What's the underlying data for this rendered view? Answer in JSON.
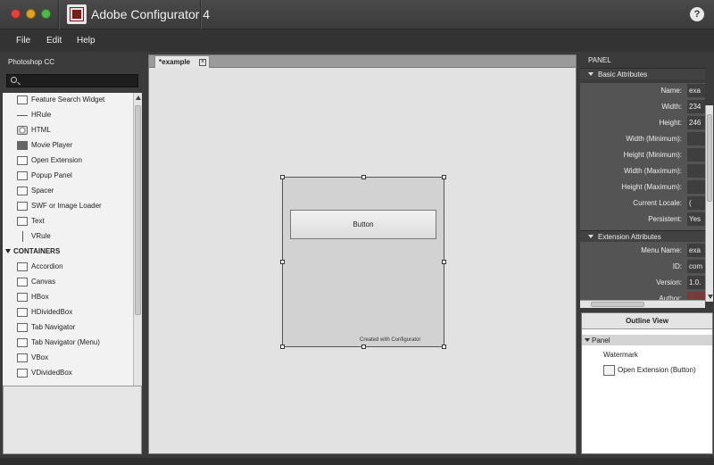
{
  "window": {
    "title": "Adobe Configurator 4",
    "help": "?"
  },
  "menu": [
    "File",
    "Edit",
    "Help"
  ],
  "left_panel": {
    "title": "Photoshop CC",
    "search_placeholder": "",
    "items": [
      {
        "label": "Feature Search Widget",
        "icon": "search-widget-icon"
      },
      {
        "label": "HRule",
        "icon": "hrule-icon"
      },
      {
        "label": "HTML",
        "icon": "html-icon"
      },
      {
        "label": "Movie Player",
        "icon": "film-icon"
      },
      {
        "label": "Open Extension",
        "icon": "window-icon"
      },
      {
        "label": "Popup Panel",
        "icon": "popup-icon"
      },
      {
        "label": "Spacer",
        "icon": "spacer-icon"
      },
      {
        "label": "SWF or Image Loader",
        "icon": "image-icon"
      },
      {
        "label": "Text",
        "icon": "text-icon"
      },
      {
        "label": "VRule",
        "icon": "vrule-icon"
      }
    ],
    "containers_label": "CONTAINERS",
    "containers": [
      {
        "label": "Accordion",
        "icon": "accordion-icon"
      },
      {
        "label": "Canvas",
        "icon": "canvas-icon"
      },
      {
        "label": "HBox",
        "icon": "hbox-icon"
      },
      {
        "label": "HDividedBox",
        "icon": "hdividedbox-icon"
      },
      {
        "label": "Tab Navigator",
        "icon": "tab-navigator-icon"
      },
      {
        "label": "Tab Navigator (Menu)",
        "icon": "tab-navigator-menu-icon"
      },
      {
        "label": "VBox",
        "icon": "vbox-icon"
      },
      {
        "label": "VDividedBox",
        "icon": "vdividedbox-icon"
      }
    ]
  },
  "document": {
    "tab_label": "*example",
    "tab_close": "×",
    "button_label": "Button",
    "watermark": "Created with Configurator"
  },
  "right_panel": {
    "title": "PANEL",
    "basic_header": "Basic Attributes",
    "basic": [
      {
        "label": "Name:",
        "value": "exa"
      },
      {
        "label": "Width:",
        "value": "234"
      },
      {
        "label": "Height:",
        "value": "246"
      },
      {
        "label": "Width (Minimum):",
        "value": ""
      },
      {
        "label": "Height (Minimum):",
        "value": ""
      },
      {
        "label": "Width (Maximum):",
        "value": ""
      },
      {
        "label": "Height (Maximum):",
        "value": ""
      },
      {
        "label": "Current Locale:",
        "value": "("
      },
      {
        "label": "Persistent:",
        "value": "Yes"
      }
    ],
    "ext_header": "Extension Attributes",
    "ext": [
      {
        "label": "Menu Name:",
        "value": "exa"
      },
      {
        "label": "ID:",
        "value": "com"
      },
      {
        "label": "Version:",
        "value": "1.0."
      },
      {
        "label": "Author:",
        "value": ""
      }
    ]
  },
  "outline": {
    "title": "Outline View",
    "root": "Panel",
    "children": [
      "Watermark",
      "Open Extension (Button)"
    ]
  },
  "colors": {
    "chrome": "#3b3b3b",
    "close": "#e0443e",
    "minimize": "#dea123",
    "maximize": "#53b84a",
    "author_field": "#7a3a3a"
  }
}
